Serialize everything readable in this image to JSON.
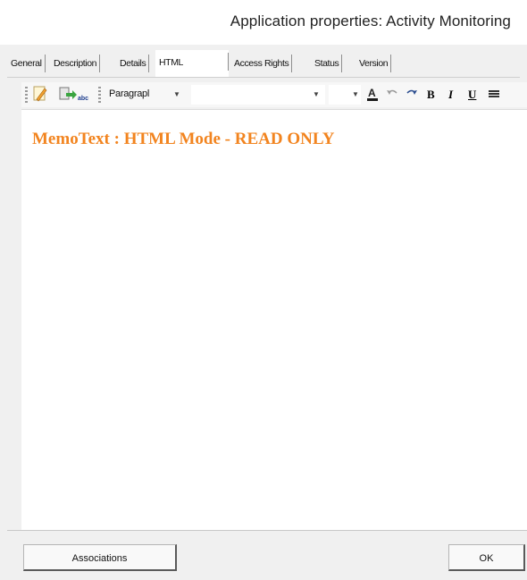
{
  "window": {
    "title": "Application properties: Activity Monitoring"
  },
  "tabs": [
    {
      "label": "General"
    },
    {
      "label": "Description"
    },
    {
      "label": "Details"
    },
    {
      "label": "HTML"
    },
    {
      "label": "Access Rights"
    },
    {
      "label": "Status"
    },
    {
      "label": "Version"
    }
  ],
  "active_tab": "HTML",
  "toolbar": {
    "paragraph_select": "Paragrapl",
    "font_select": "",
    "size_select": "",
    "bold_label": "B",
    "italic_label": "I",
    "underline_label": "U"
  },
  "editor": {
    "content": "MemoText : HTML Mode - READ ONLY",
    "text_color": "#f2841f"
  },
  "buttons": {
    "associations": "Associations",
    "ok": "OK"
  }
}
